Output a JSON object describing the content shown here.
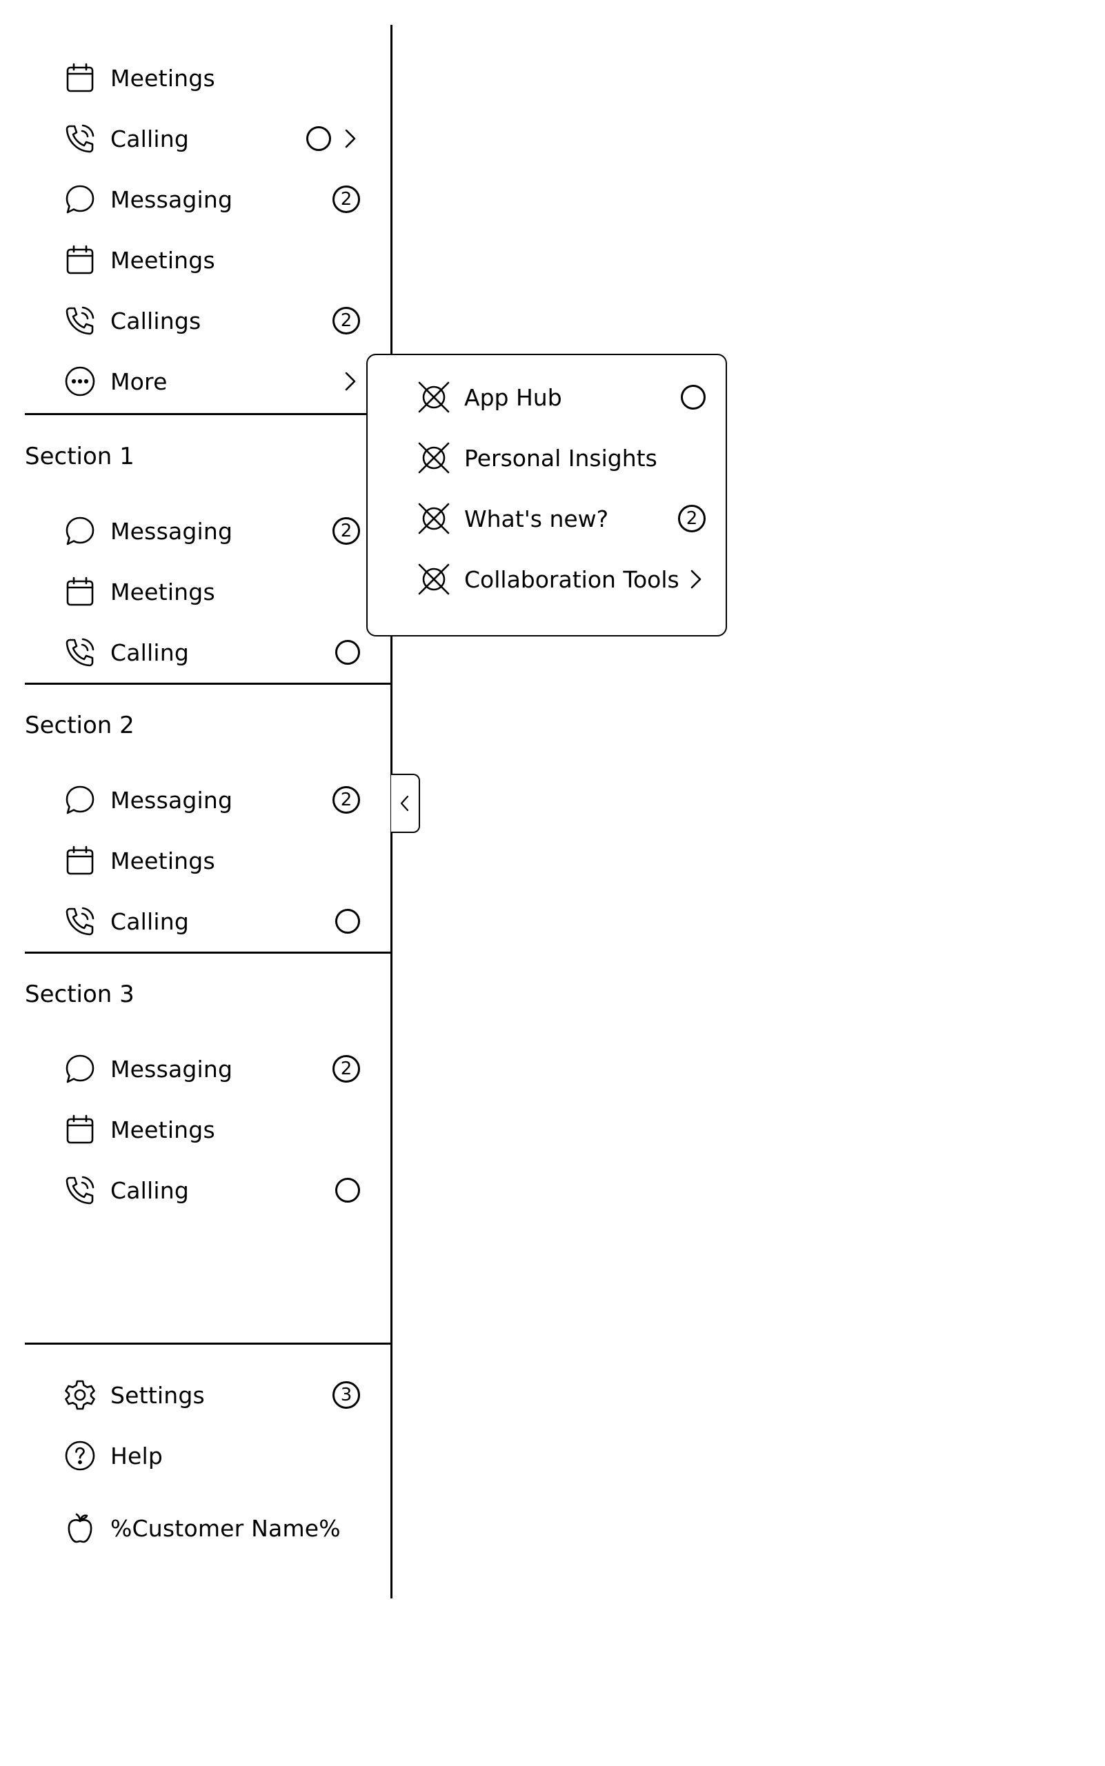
{
  "nav_top": [
    {
      "label": "Meetings",
      "icon": "calendar-icon"
    },
    {
      "label": "Calling",
      "icon": "phone-icon",
      "status": true,
      "chevron": true
    },
    {
      "label": "Messaging",
      "icon": "chat-icon",
      "badge": "2"
    },
    {
      "label": "Meetings",
      "icon": "calendar-icon"
    },
    {
      "label": "Callings",
      "icon": "phone-icon",
      "badge": "2"
    },
    {
      "label": "More",
      "icon": "more-icon",
      "chevron": true
    }
  ],
  "sections": [
    {
      "title": "Section 1",
      "items": [
        {
          "label": "Messaging",
          "icon": "chat-icon",
          "badge": "2"
        },
        {
          "label": "Meetings",
          "icon": "calendar-icon"
        },
        {
          "label": "Calling",
          "icon": "phone-icon",
          "status": true
        }
      ]
    },
    {
      "title": "Section 2",
      "items": [
        {
          "label": "Messaging",
          "icon": "chat-icon",
          "badge": "2"
        },
        {
          "label": "Meetings",
          "icon": "calendar-icon"
        },
        {
          "label": "Calling",
          "icon": "phone-icon",
          "status": true
        }
      ]
    },
    {
      "title": "Section 3",
      "items": [
        {
          "label": "Messaging",
          "icon": "chat-icon",
          "badge": "2"
        },
        {
          "label": "Meetings",
          "icon": "calendar-icon"
        },
        {
          "label": "Calling",
          "icon": "phone-icon",
          "status": true
        }
      ]
    }
  ],
  "footer": {
    "settings": {
      "label": "Settings",
      "icon": "gear-icon",
      "badge": "3"
    },
    "help": {
      "label": "Help",
      "icon": "help-icon"
    },
    "customer": {
      "label": "%Customer Name%",
      "icon": "apple-logo-icon"
    }
  },
  "flyout": {
    "items": [
      {
        "label": "App Hub",
        "icon": "placeholder-icon",
        "status": true
      },
      {
        "label": "Personal Insights",
        "icon": "placeholder-icon"
      },
      {
        "label": "What's new?",
        "icon": "placeholder-icon",
        "badge": "2"
      },
      {
        "label": "Collaboration Tools",
        "icon": "placeholder-icon",
        "chevron": true
      }
    ]
  },
  "collapse_handle": {
    "icon": "chevron-left-icon"
  }
}
